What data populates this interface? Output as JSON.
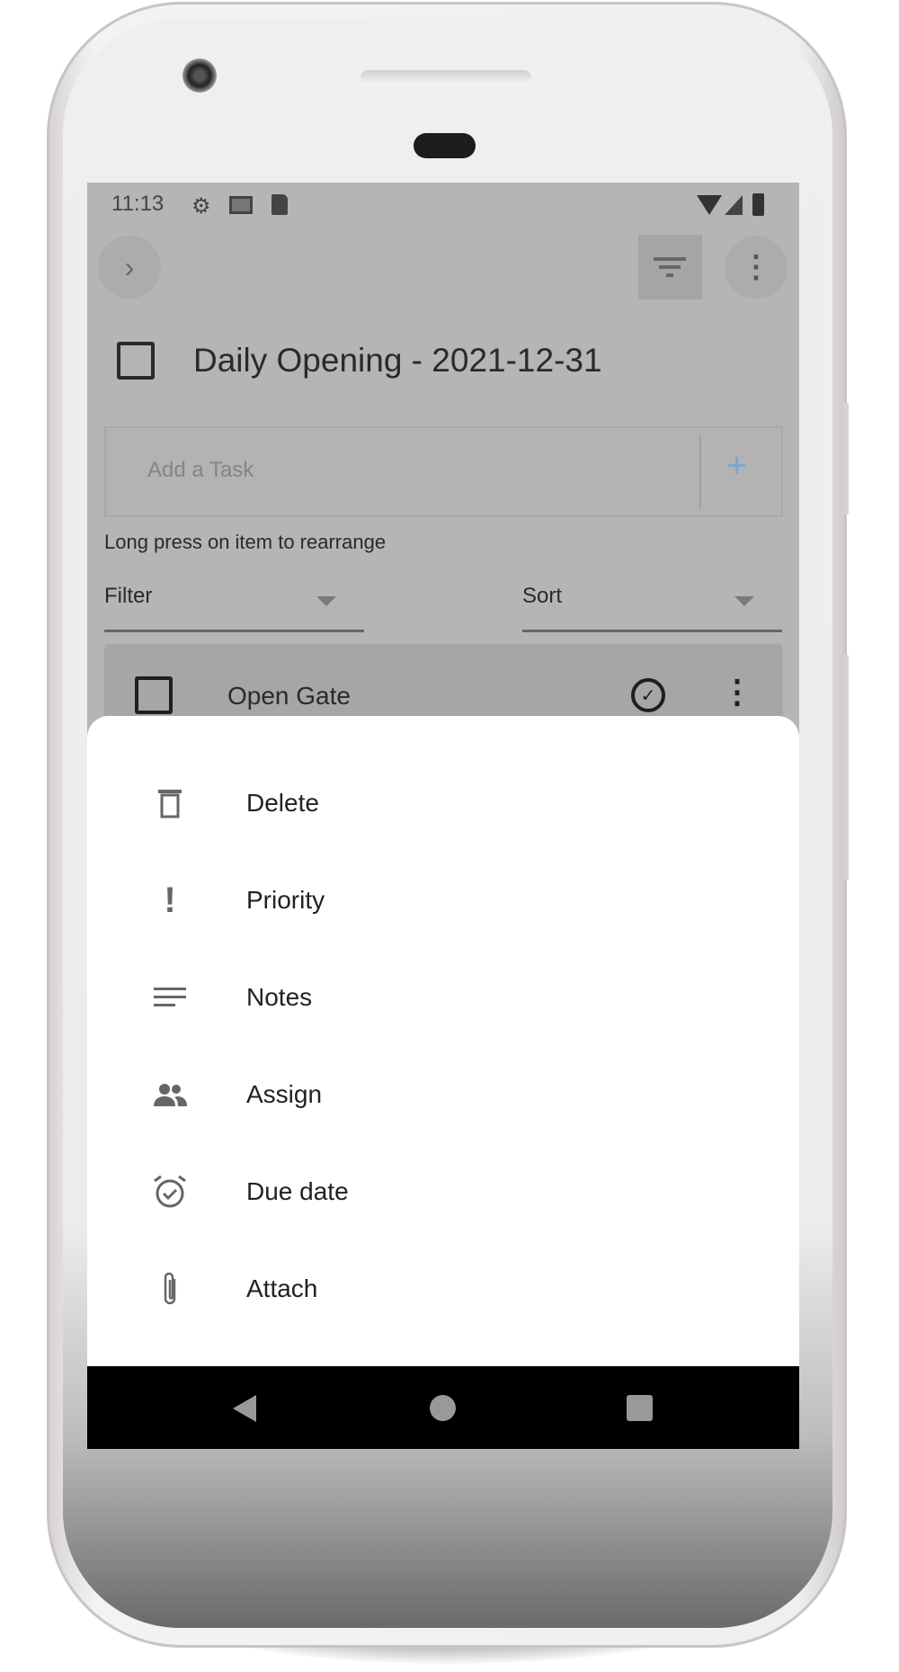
{
  "status_bar": {
    "time": "11:13",
    "icons": [
      "gear-icon",
      "gmail-icon",
      "sd-card-icon",
      "wifi-icon",
      "signal-icon",
      "battery-icon"
    ]
  },
  "toolbar": {
    "expand_icon": "chevron-right-icon",
    "filter_icon": "filter-icon",
    "more_icon": "more-vert-icon"
  },
  "list": {
    "title": "Daily Opening - 2021-12-31",
    "checked": false
  },
  "add_task": {
    "placeholder": "Add a Task",
    "add_label": "+"
  },
  "hint": "Long press on item to rearrange",
  "filter": {
    "label": "Filter"
  },
  "sort": {
    "label": "Sort"
  },
  "tasks": [
    {
      "title": "Open Gate",
      "checked": false
    }
  ],
  "bottom_sheet": {
    "items": [
      {
        "label": "Delete",
        "icon": "trash-icon"
      },
      {
        "label": "Priority",
        "icon": "exclamation-icon"
      },
      {
        "label": "Notes",
        "icon": "notes-icon"
      },
      {
        "label": "Assign",
        "icon": "people-icon"
      },
      {
        "label": "Due date",
        "icon": "alarm-check-icon"
      },
      {
        "label": "Attach",
        "icon": "paperclip-icon"
      }
    ]
  },
  "colors": {
    "accent": "#7fa6c9",
    "overlay": "#b5b5b5",
    "sheet": "#ffffff"
  }
}
